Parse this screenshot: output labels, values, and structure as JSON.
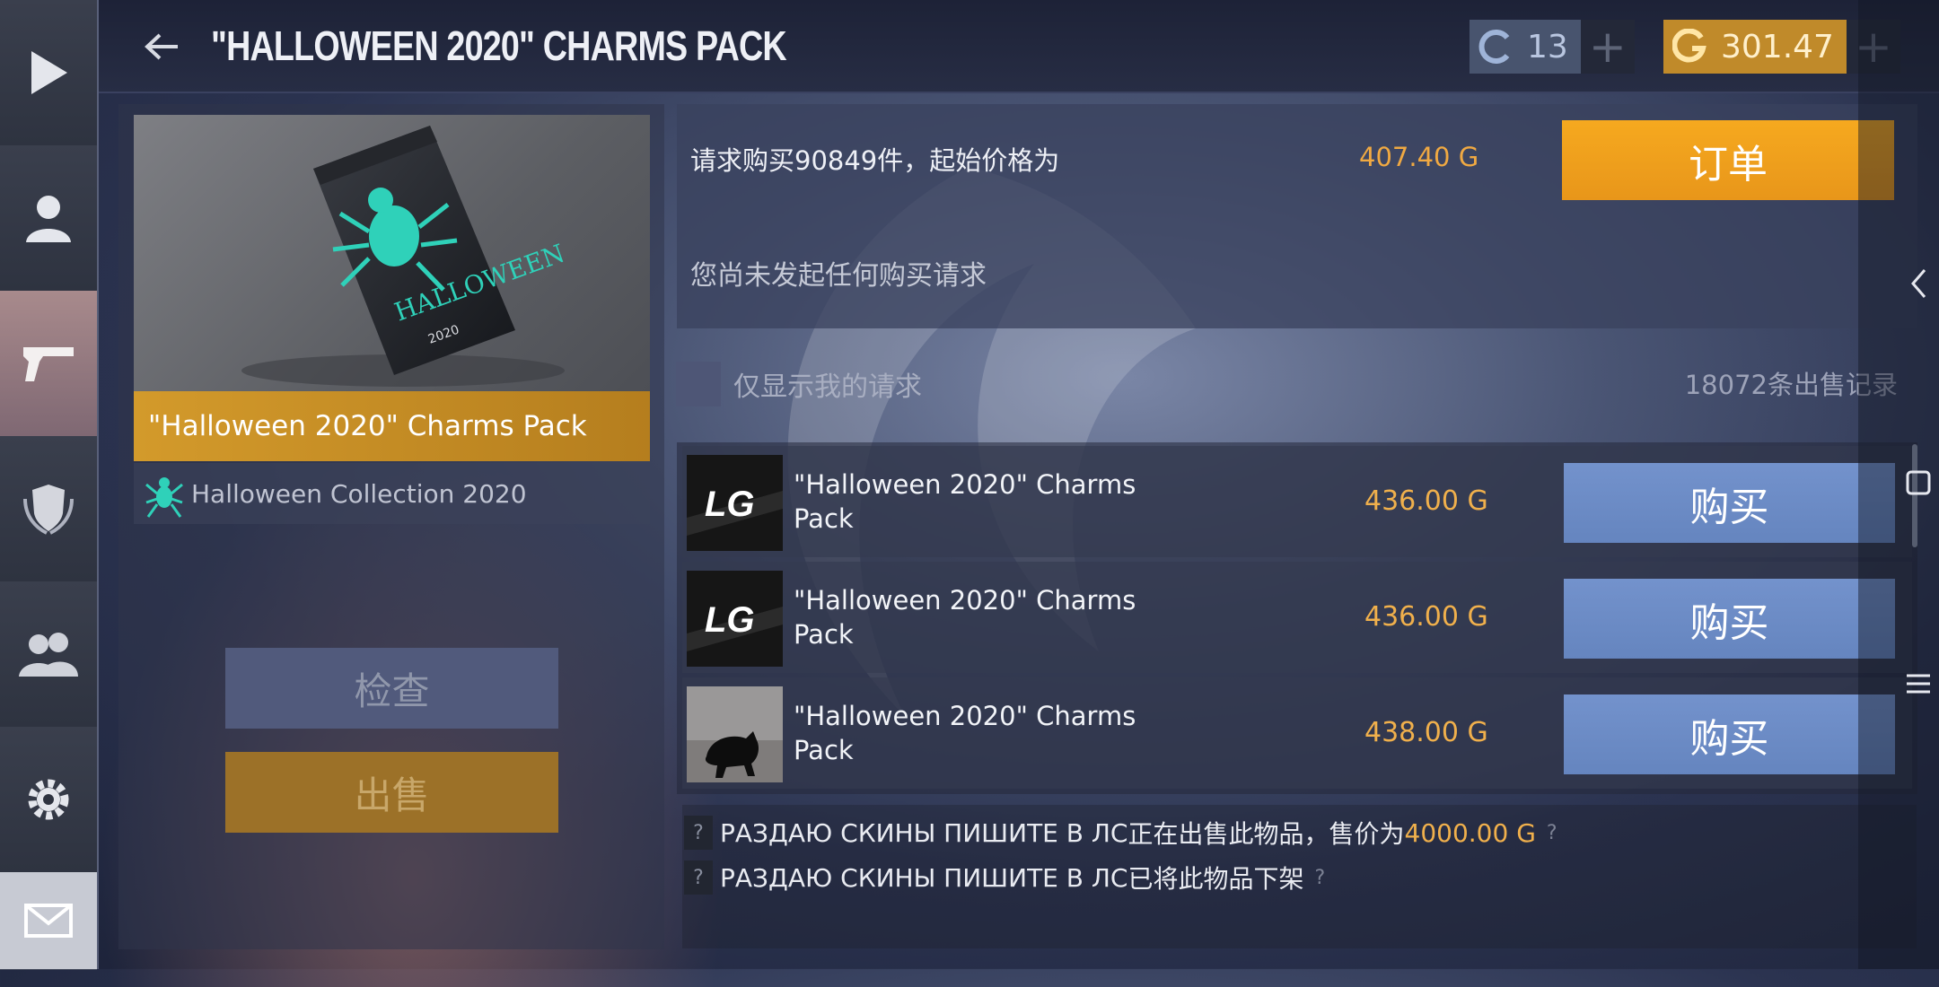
{
  "header": {
    "title": "\"HALLOWEEN 2020\" CHARMS PACK",
    "credits": "13",
    "gold": "301.47"
  },
  "sidebar": {
    "items": [
      "play-icon",
      "profile-icon",
      "weapon-icon",
      "clan-badge-icon",
      "friends-icon",
      "settings-icon",
      "mail-icon"
    ]
  },
  "item": {
    "name": "\"Halloween 2020\" Charms Pack",
    "collection": "Halloween Collection 2020",
    "inspect_label": "检查",
    "sell_label": "出售"
  },
  "request": {
    "text": "请求购买90849件，起始价格为",
    "price": "407.40 G",
    "order_label": "订单",
    "no_requests": "您尚未发起任何购买请求"
  },
  "filter": {
    "only_mine_label": "仅显示我的请求",
    "sales_count": "18072条出售记录"
  },
  "listings": [
    {
      "name": "\"Halloween 2020\" Charms Pack",
      "price": "436.00 G",
      "buy_label": "购买",
      "thumb": "LG"
    },
    {
      "name": "\"Halloween 2020\" Charms Pack",
      "price": "436.00 G",
      "buy_label": "购买",
      "thumb": "LG"
    },
    {
      "name": "\"Halloween 2020\" Charms Pack",
      "price": "438.00 G",
      "buy_label": "购买",
      "thumb": "cat"
    }
  ],
  "activity": [
    {
      "user": "РАЗДАЮ СКИНЫ ПИШИТЕ В ЛС",
      "text": "正在出售此物品，售价为",
      "price": "4000.00 G"
    },
    {
      "user": "РАЗДАЮ СКИНЫ ПИШИТЕ В ЛС",
      "text": "已将此物品下架",
      "price": ""
    }
  ],
  "colors": {
    "accent_gold": "#f0a942",
    "buy_blue": "#6f8ec9",
    "order_orange": "#f4a31e"
  }
}
